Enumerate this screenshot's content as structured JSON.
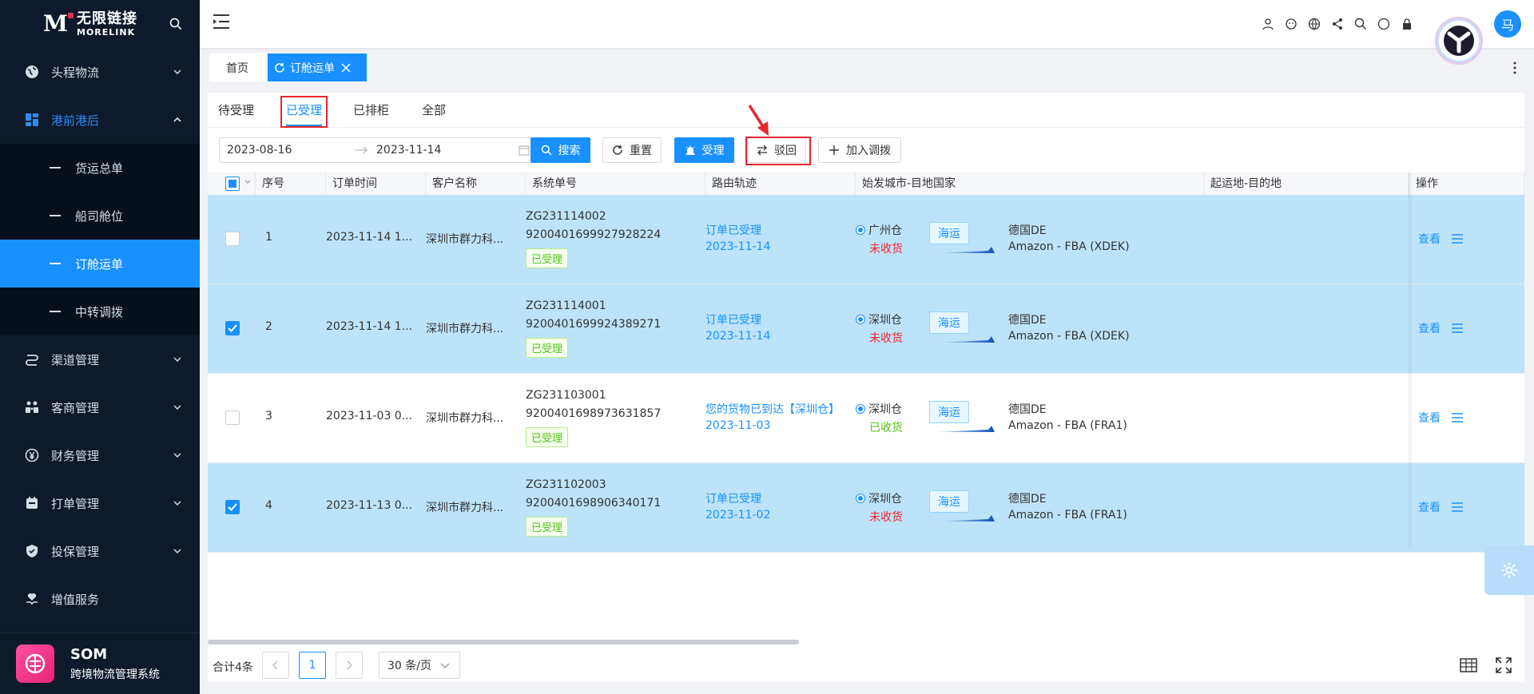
{
  "sidebar": {
    "logo_cn": "无限链接",
    "logo_en": "MORELINK",
    "items": [
      {
        "label": "头程物流",
        "icon": "globe-icon"
      },
      {
        "label": "港前港后",
        "icon": "grid-icon"
      },
      {
        "label": "渠道管理",
        "icon": "route-icon"
      },
      {
        "label": "客商管理",
        "icon": "people-icon"
      },
      {
        "label": "财务管理",
        "icon": "yen-icon"
      },
      {
        "label": "打单管理",
        "icon": "print-icon"
      },
      {
        "label": "投保管理",
        "icon": "shield-icon"
      },
      {
        "label": "增值服务",
        "icon": "heart-hand-icon"
      }
    ],
    "subitems": [
      "货运总单",
      "船司舱位",
      "订舱运单",
      "中转调拨"
    ],
    "som_title": "SOM",
    "som_sub": "跨境物流管理系统"
  },
  "header": {
    "avatar": "马"
  },
  "tagbar": {
    "home": "首页",
    "active": "订舱运单"
  },
  "tabs": [
    "待受理",
    "已受理",
    "已排柜",
    "全部"
  ],
  "toolbar": {
    "date_start": "2023-08-16",
    "date_end": "2023-11-14",
    "search": "搜索",
    "reset": "重置",
    "accept": "受理",
    "reject": "驳回",
    "add_transfer": "加入调拨"
  },
  "table": {
    "columns": [
      "序号",
      "订单时间",
      "客户名称",
      "系统单号",
      "路由轨迹",
      "始发城市-目地国家",
      "起运地-目的地",
      "操作"
    ],
    "rows": [
      {
        "no": "1",
        "time": "2023-11-14 1...",
        "customer": "深圳市群力科...",
        "sys1": "ZG231114002",
        "sys2": "9200401699927928224",
        "status": "已受理",
        "route": "订单已受理",
        "route_date": "2023-11-14",
        "origin": "广州仓",
        "recv": "未收货",
        "mode": "海运",
        "country": "德国DE",
        "dest": "Amazon - FBA (XDEK)",
        "view": "查看"
      },
      {
        "no": "2",
        "time": "2023-11-14 1...",
        "customer": "深圳市群力科...",
        "sys1": "ZG231114001",
        "sys2": "9200401699924389271",
        "status": "已受理",
        "route": "订单已受理",
        "route_date": "2023-11-14",
        "origin": "深圳仓",
        "recv": "未收货",
        "mode": "海运",
        "country": "德国DE",
        "dest": "Amazon - FBA (XDEK)",
        "view": "查看"
      },
      {
        "no": "3",
        "time": "2023-11-03 0...",
        "customer": "深圳市群力科...",
        "sys1": "ZG231103001",
        "sys2": "9200401698973631857",
        "status": "已受理",
        "route": "您的货物已到达【深圳仓】",
        "route_date": "2023-11-03",
        "origin": "深圳仓",
        "recv": "已收货",
        "mode": "海运",
        "country": "德国DE",
        "dest": "Amazon - FBA (FRA1)",
        "view": "查看"
      },
      {
        "no": "4",
        "time": "2023-11-13 0...",
        "customer": "深圳市群力科...",
        "sys1": "ZG231102003",
        "sys2": "9200401698906340171",
        "status": "已受理",
        "route": "订单已受理",
        "route_date": "2023-11-02",
        "origin": "深圳仓",
        "recv": "未收货",
        "mode": "海运",
        "country": "德国DE",
        "dest": "Amazon - FBA (FRA1)",
        "view": "查看"
      }
    ]
  },
  "pager": {
    "total": "合计4条",
    "page": "1",
    "size": "30 条/页"
  }
}
